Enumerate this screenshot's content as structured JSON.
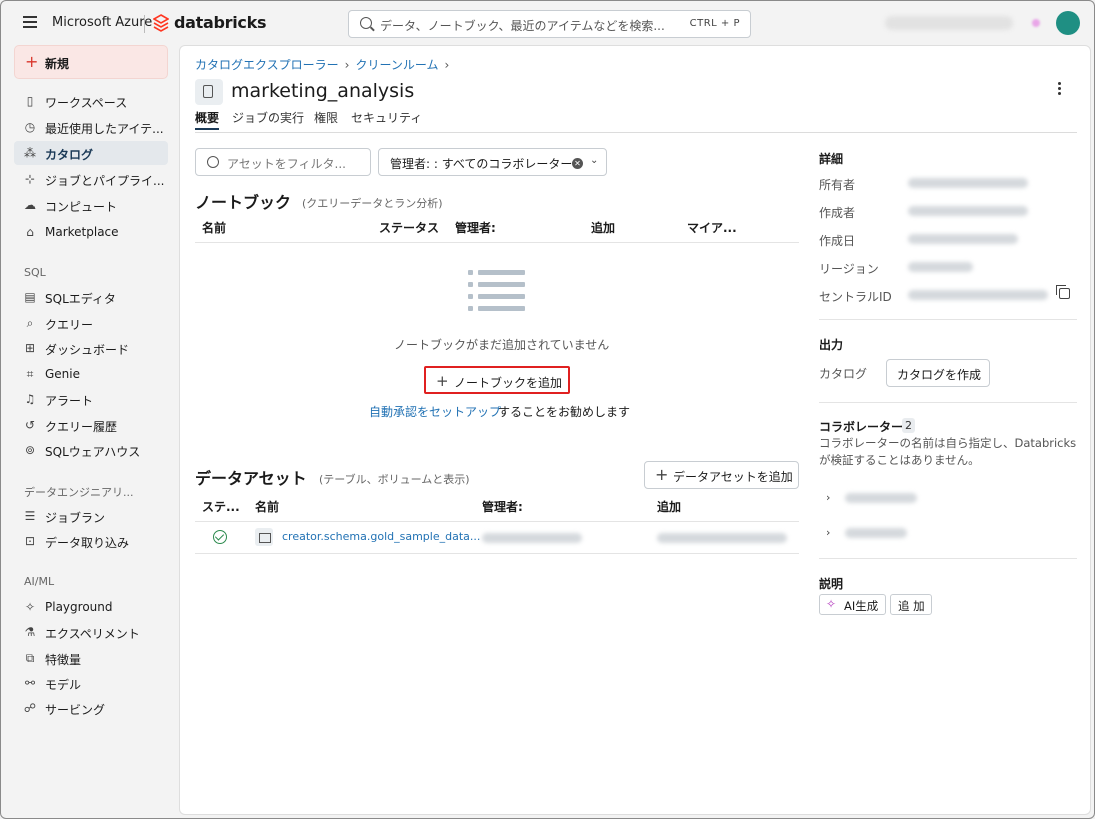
{
  "topbar": {
    "ms_azure": "Microsoft Azure",
    "brand": "databricks",
    "search_placeholder": "データ、ノートブック、最近のアイテムなどを検索...",
    "search_shortcut": "CTRL + P",
    "colors": {
      "avatar": "#1f8f83",
      "brand": "#ff3621"
    }
  },
  "sidebar": {
    "new_label": "新規",
    "items_top": [
      {
        "label": "ワークスペース",
        "icon": "folder-icon"
      },
      {
        "label": "最近使用したアイテ...",
        "icon": "clock-icon"
      },
      {
        "label": "カタログ",
        "icon": "catalog-icon",
        "active": true
      },
      {
        "label": "ジョブとパイプライ...",
        "icon": "workflow-icon"
      },
      {
        "label": "コンピュート",
        "icon": "cloud-icon"
      },
      {
        "label": "Marketplace",
        "icon": "store-icon"
      }
    ],
    "sql_section": "SQL",
    "items_sql": [
      {
        "label": "SQLエディタ",
        "icon": "editor-icon"
      },
      {
        "label": "クエリー",
        "icon": "query-icon"
      },
      {
        "label": "ダッシュボード",
        "icon": "dashboard-icon"
      },
      {
        "label": "Genie",
        "icon": "genie-icon"
      },
      {
        "label": "アラート",
        "icon": "bell-icon"
      },
      {
        "label": "クエリー履歴",
        "icon": "history-icon"
      },
      {
        "label": "SQLウェアハウス",
        "icon": "warehouse-icon"
      }
    ],
    "de_section": "データエンジニアリ...",
    "items_de": [
      {
        "label": "ジョブラン",
        "icon": "list-icon"
      },
      {
        "label": "データ取り込み",
        "icon": "ingest-icon"
      }
    ],
    "ml_section": "AI/ML",
    "items_ml": [
      {
        "label": "Playground",
        "icon": "sparkle-icon"
      },
      {
        "label": "エクスペリメント",
        "icon": "flask-icon"
      },
      {
        "label": "特徴量",
        "icon": "feature-icon"
      },
      {
        "label": "モデル",
        "icon": "model-icon"
      },
      {
        "label": "サービング",
        "icon": "serving-icon"
      }
    ]
  },
  "main": {
    "breadcrumb": [
      "カタログエクスプローラー",
      "クリーンルーム"
    ],
    "breadcrumb_sep": "›",
    "title": "marketing_analysis",
    "tabs": [
      "概要",
      "ジョブの実行",
      "権限",
      "セキュリティ"
    ],
    "filter_placeholder": "アセットをフィルタ...",
    "owner_filter": "管理者: : すべてのコラボレーター",
    "notebooks": {
      "title": "ノートブック",
      "subtitle": "(クエリーデータとラン分析)",
      "columns": [
        "名前",
        "ステータス",
        "管理者:",
        "追加",
        "マイア..."
      ],
      "empty_text": "ノートブックがまだ追加されていません",
      "add_button": "ノートブックを追加",
      "auto_link": "自動承認をセットアップ",
      "auto_rest": "することをお勧めします"
    },
    "data_assets": {
      "title": "データアセット",
      "subtitle": "(テーブル、ボリュームと表示)",
      "add_button": "データアセットを追加",
      "columns": [
        "ステ...",
        "名前",
        "管理者:",
        "追加"
      ],
      "rows": [
        {
          "status": "ok",
          "name": "creator.schema.gold_sample_data..."
        }
      ]
    }
  },
  "details": {
    "title": "詳細",
    "keys": [
      "所有者",
      "作成者",
      "作成日",
      "リージョン",
      "セントラルID"
    ],
    "output_title": "出力",
    "catalog_key": "カタログ",
    "create_catalog": "カタログを作成",
    "collab_title": "コラボレーター",
    "collab_count": "2",
    "collab_desc": "コラボレーターの名前は自ら指定し、Databricks が検証することはありません。",
    "desc_title": "説明",
    "ai_button": "AI生成",
    "add_button": "追 加"
  }
}
